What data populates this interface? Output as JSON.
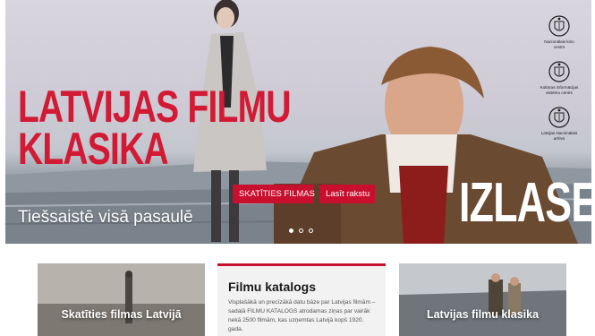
{
  "hero": {
    "title_line1": "LATVIJAS FILMU",
    "title_line2": "KLASIKA",
    "subtitle": "Tiešsaistē visā pasaulē",
    "buttons": {
      "watch": "SKATĪTIES FILMAS",
      "read": "Lasīt rakstu"
    },
    "izlase": "IZLASE",
    "slides": {
      "count": 3,
      "active_index": 0
    },
    "colors": {
      "brand_red": "#c8102e",
      "title_red": "#d21a35"
    }
  },
  "logos": [
    {
      "icon": "coat-of-arms-icon",
      "line1": "Nacionālais kino",
      "line2": "centrs"
    },
    {
      "icon": "coat-of-arms-icon",
      "line1": "Kultūras informācijas",
      "line2": "sistēmu centrs"
    },
    {
      "icon": "coat-of-arms-icon",
      "line1": "Latvijas Nacionālais",
      "line2": "arhīvs"
    }
  ],
  "cards": {
    "left": {
      "label": "Skatīties filmas Latvijā"
    },
    "middle": {
      "title": "Filmu katalogs",
      "text": "Visplašākā un precīzākā datu bāze par Latvijas filmām – sadaļā FILMU KATALOGS atrodamas ziņas par vairāk nekā 2500 filmām, kas uzņemtas Latvijā kopš 1920. gada."
    },
    "right": {
      "label": "Latvijas filmu klasika"
    }
  }
}
